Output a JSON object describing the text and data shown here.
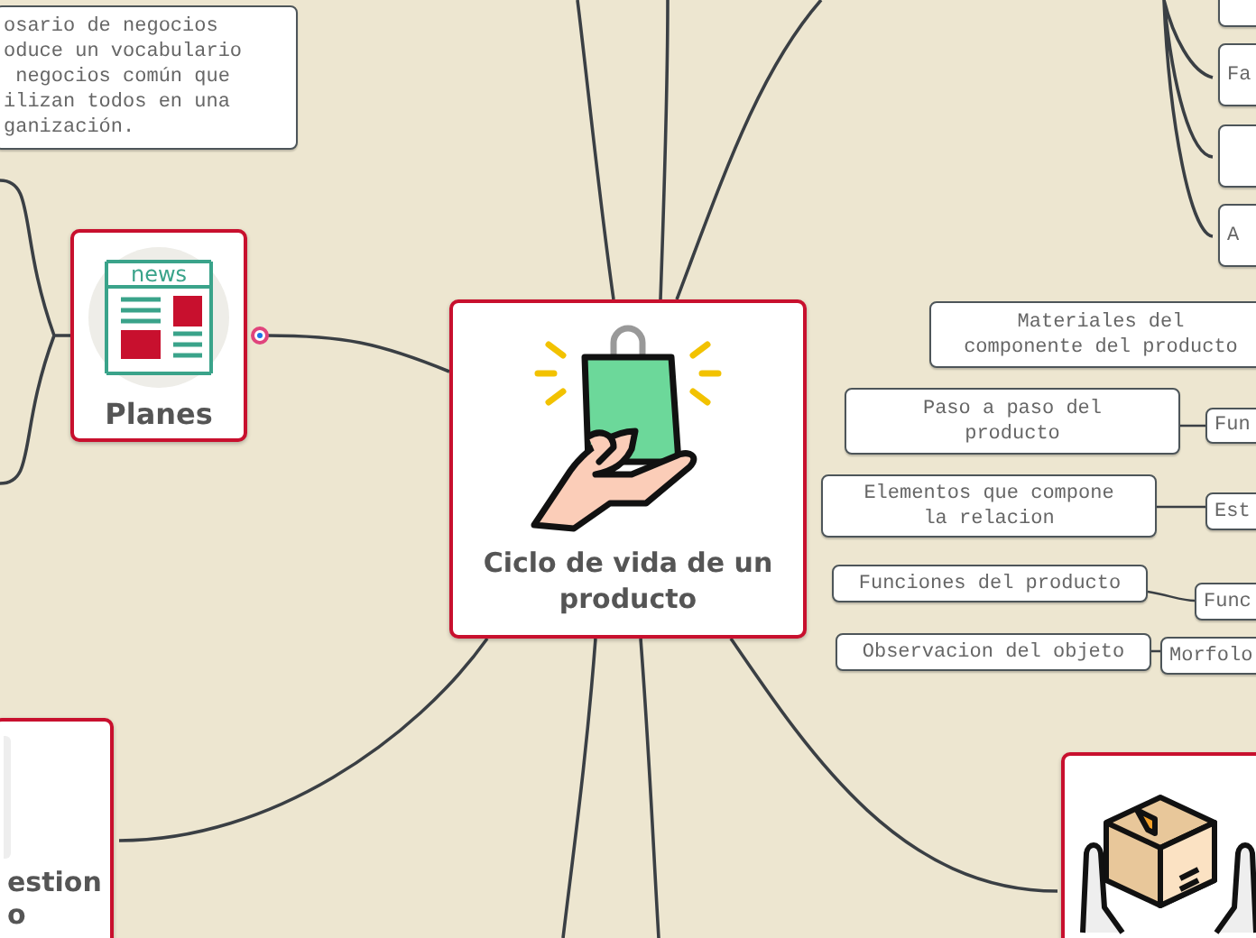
{
  "central_topic": {
    "label": "Ciclo de vida de un producto"
  },
  "cards": [
    {
      "label": "Planes",
      "icon_label": "news"
    },
    {
      "label": "estion\no"
    }
  ],
  "notes": [
    {
      "text": "osario de negocios\noduce un vocabulario\n negocios común que\nilizan todos en una\nganización."
    },
    {
      "text": "Fa"
    },
    {
      "text": "A"
    },
    {
      "text": "Materiales del\ncomponente del producto"
    },
    {
      "text": "Paso a paso del\nproducto"
    },
    {
      "text": "Fun"
    },
    {
      "text": "Elementos que compone\nla relacion"
    },
    {
      "text": "Est"
    },
    {
      "text": "Funciones del producto"
    },
    {
      "text": "Func"
    },
    {
      "text": "Observacion del objeto"
    },
    {
      "text": "Morfolo"
    }
  ]
}
